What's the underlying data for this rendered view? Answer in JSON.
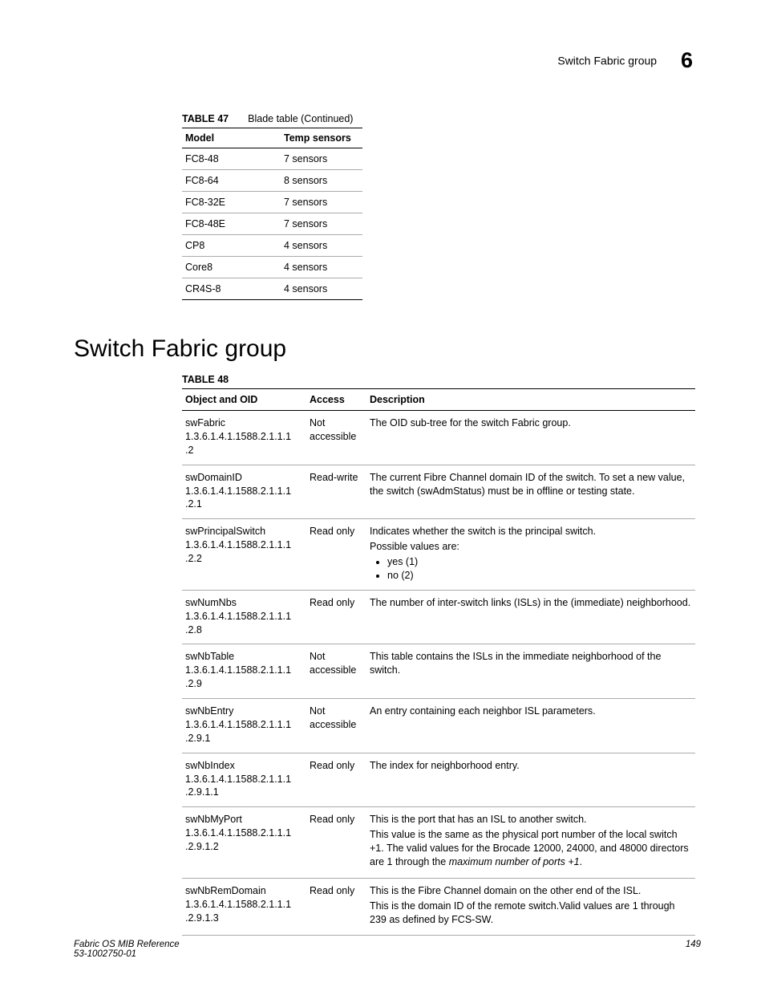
{
  "header": {
    "section_title": "Switch Fabric group",
    "chapter_number": "6"
  },
  "table47": {
    "label": "TABLE 47",
    "title": "Blade table (Continued)",
    "headers": [
      "Model",
      "Temp sensors"
    ],
    "rows": [
      [
        "FC8-48",
        "7 sensors"
      ],
      [
        "FC8-64",
        "8 sensors"
      ],
      [
        "FC8-32E",
        "7 sensors"
      ],
      [
        "FC8-48E",
        "7 sensors"
      ],
      [
        "CP8",
        "4 sensors"
      ],
      [
        "Core8",
        "4 sensors"
      ],
      [
        "CR4S-8",
        "4 sensors"
      ]
    ]
  },
  "section_heading": "Switch Fabric group",
  "table48": {
    "label": "TABLE 48",
    "headers": [
      "Object and OID",
      "Access",
      "Description"
    ],
    "rows": [
      {
        "name": "swFabric",
        "oid": "1.3.6.1.4.1.1588.2.1.1.1.2",
        "access": "Not accessible",
        "desc_paras": [
          "The OID sub-tree for the switch Fabric group."
        ]
      },
      {
        "name": "swDomainID",
        "oid": "1.3.6.1.4.1.1588.2.1.1.1.2.1",
        "access": "Read-write",
        "desc_paras": [
          "The current Fibre Channel domain ID of the switch. To set a new value, the switch (swAdmStatus) must be in offline or testing state."
        ]
      },
      {
        "name": "swPrincipalSwitch",
        "oid": "1.3.6.1.4.1.1588.2.1.1.1.2.2",
        "access": "Read only",
        "desc_paras": [
          "Indicates whether the switch is the principal switch.",
          "Possible values are:"
        ],
        "bullets": [
          "yes (1)",
          "no (2)"
        ]
      },
      {
        "name": "swNumNbs",
        "oid": "1.3.6.1.4.1.1588.2.1.1.1.2.8",
        "access": "Read only",
        "desc_paras": [
          "The number of inter-switch links (ISLs) in the (immediate) neighborhood."
        ]
      },
      {
        "name": "swNbTable",
        "oid": "1.3.6.1.4.1.1588.2.1.1.1.2.9",
        "access": "Not accessible",
        "desc_paras": [
          "This table contains the ISLs in the immediate neighborhood of the switch."
        ]
      },
      {
        "name": "swNbEntry",
        "oid": "1.3.6.1.4.1.1588.2.1.1.1.2.9.1",
        "access": "Not accessible",
        "desc_paras": [
          "An entry containing each neighbor ISL parameters."
        ]
      },
      {
        "name": "swNbIndex",
        "oid": "1.3.6.1.4.1.1588.2.1.1.1.2.9.1.1",
        "access": "Read only",
        "desc_paras": [
          "The index for neighborhood entry."
        ]
      },
      {
        "name": "swNbMyPort",
        "oid": "1.3.6.1.4.1.1588.2.1.1.1.2.9.1.2",
        "access": "Read only",
        "desc_paras": [
          "This is the port that has an ISL to another switch."
        ],
        "desc_html": "This value is the same as the physical port number of the local switch +1. The valid values for the Brocade 12000, 24000, and 48000 directors are 1 through the <span class=\"italic\">maximum number of ports +1</span>."
      },
      {
        "name": "swNbRemDomain",
        "oid": "1.3.6.1.4.1.1588.2.1.1.1.2.9.1.3",
        "access": "Read only",
        "desc_paras": [
          "This is the Fibre Channel domain on the other end of the ISL.",
          "This is the domain ID of the remote switch.Valid values are 1 through 239 as defined by FCS-SW."
        ]
      }
    ]
  },
  "footer": {
    "line1": "Fabric OS MIB Reference",
    "line2": "53-1002750-01",
    "page": "149"
  }
}
